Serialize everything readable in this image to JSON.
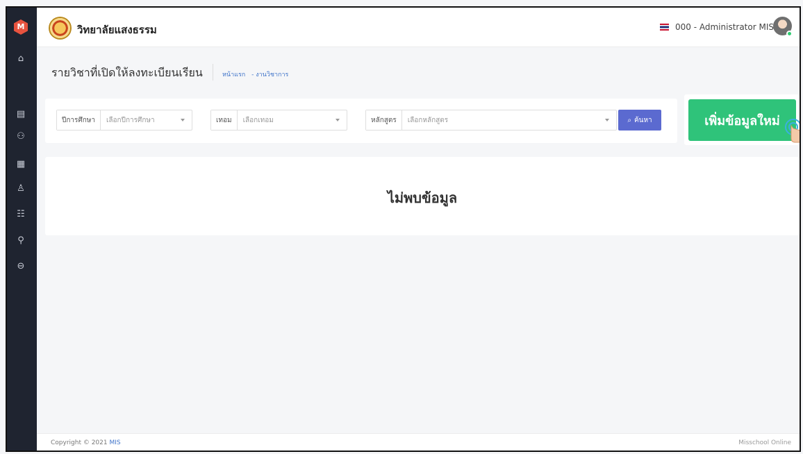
{
  "header": {
    "school_name": "วิทยาลัยแสงธรรม",
    "user": "000 - Administrator MIS"
  },
  "page": {
    "title": "รายวิชาที่เปิดให้ลงทะเบียนเรียน",
    "breadcrumb": [
      "หน้าแรก",
      "- งานวิชาการ"
    ]
  },
  "filters": {
    "year": {
      "label": "ปีการศึกษา",
      "placeholder": "เลือกปีการศึกษา"
    },
    "term": {
      "label": "เทอม",
      "placeholder": "เลือกเทอม"
    },
    "curriculum": {
      "label": "หลักสูตร",
      "placeholder": "เลือกหลักสูตร"
    },
    "search_label": "ค้นหา"
  },
  "add_button": "เพิ่มข้อมูลใหม่",
  "empty_message": "ไม่พบข้อมูล",
  "footer": {
    "copyright_prefix": "Copyright © 2021",
    "copyright_brand": "MIS",
    "right": "Misschool Online"
  },
  "icons": {
    "sidebar": [
      "home-icon",
      "document-icon",
      "people-icon",
      "id-card-icon",
      "user-check-icon",
      "money-icon",
      "user-settings-icon",
      "logout-icon"
    ]
  },
  "colors": {
    "sidebar": "#1f2430",
    "accent_green": "#2fc37a",
    "search_button": "#5b6ad0",
    "link": "#3e73c9"
  }
}
